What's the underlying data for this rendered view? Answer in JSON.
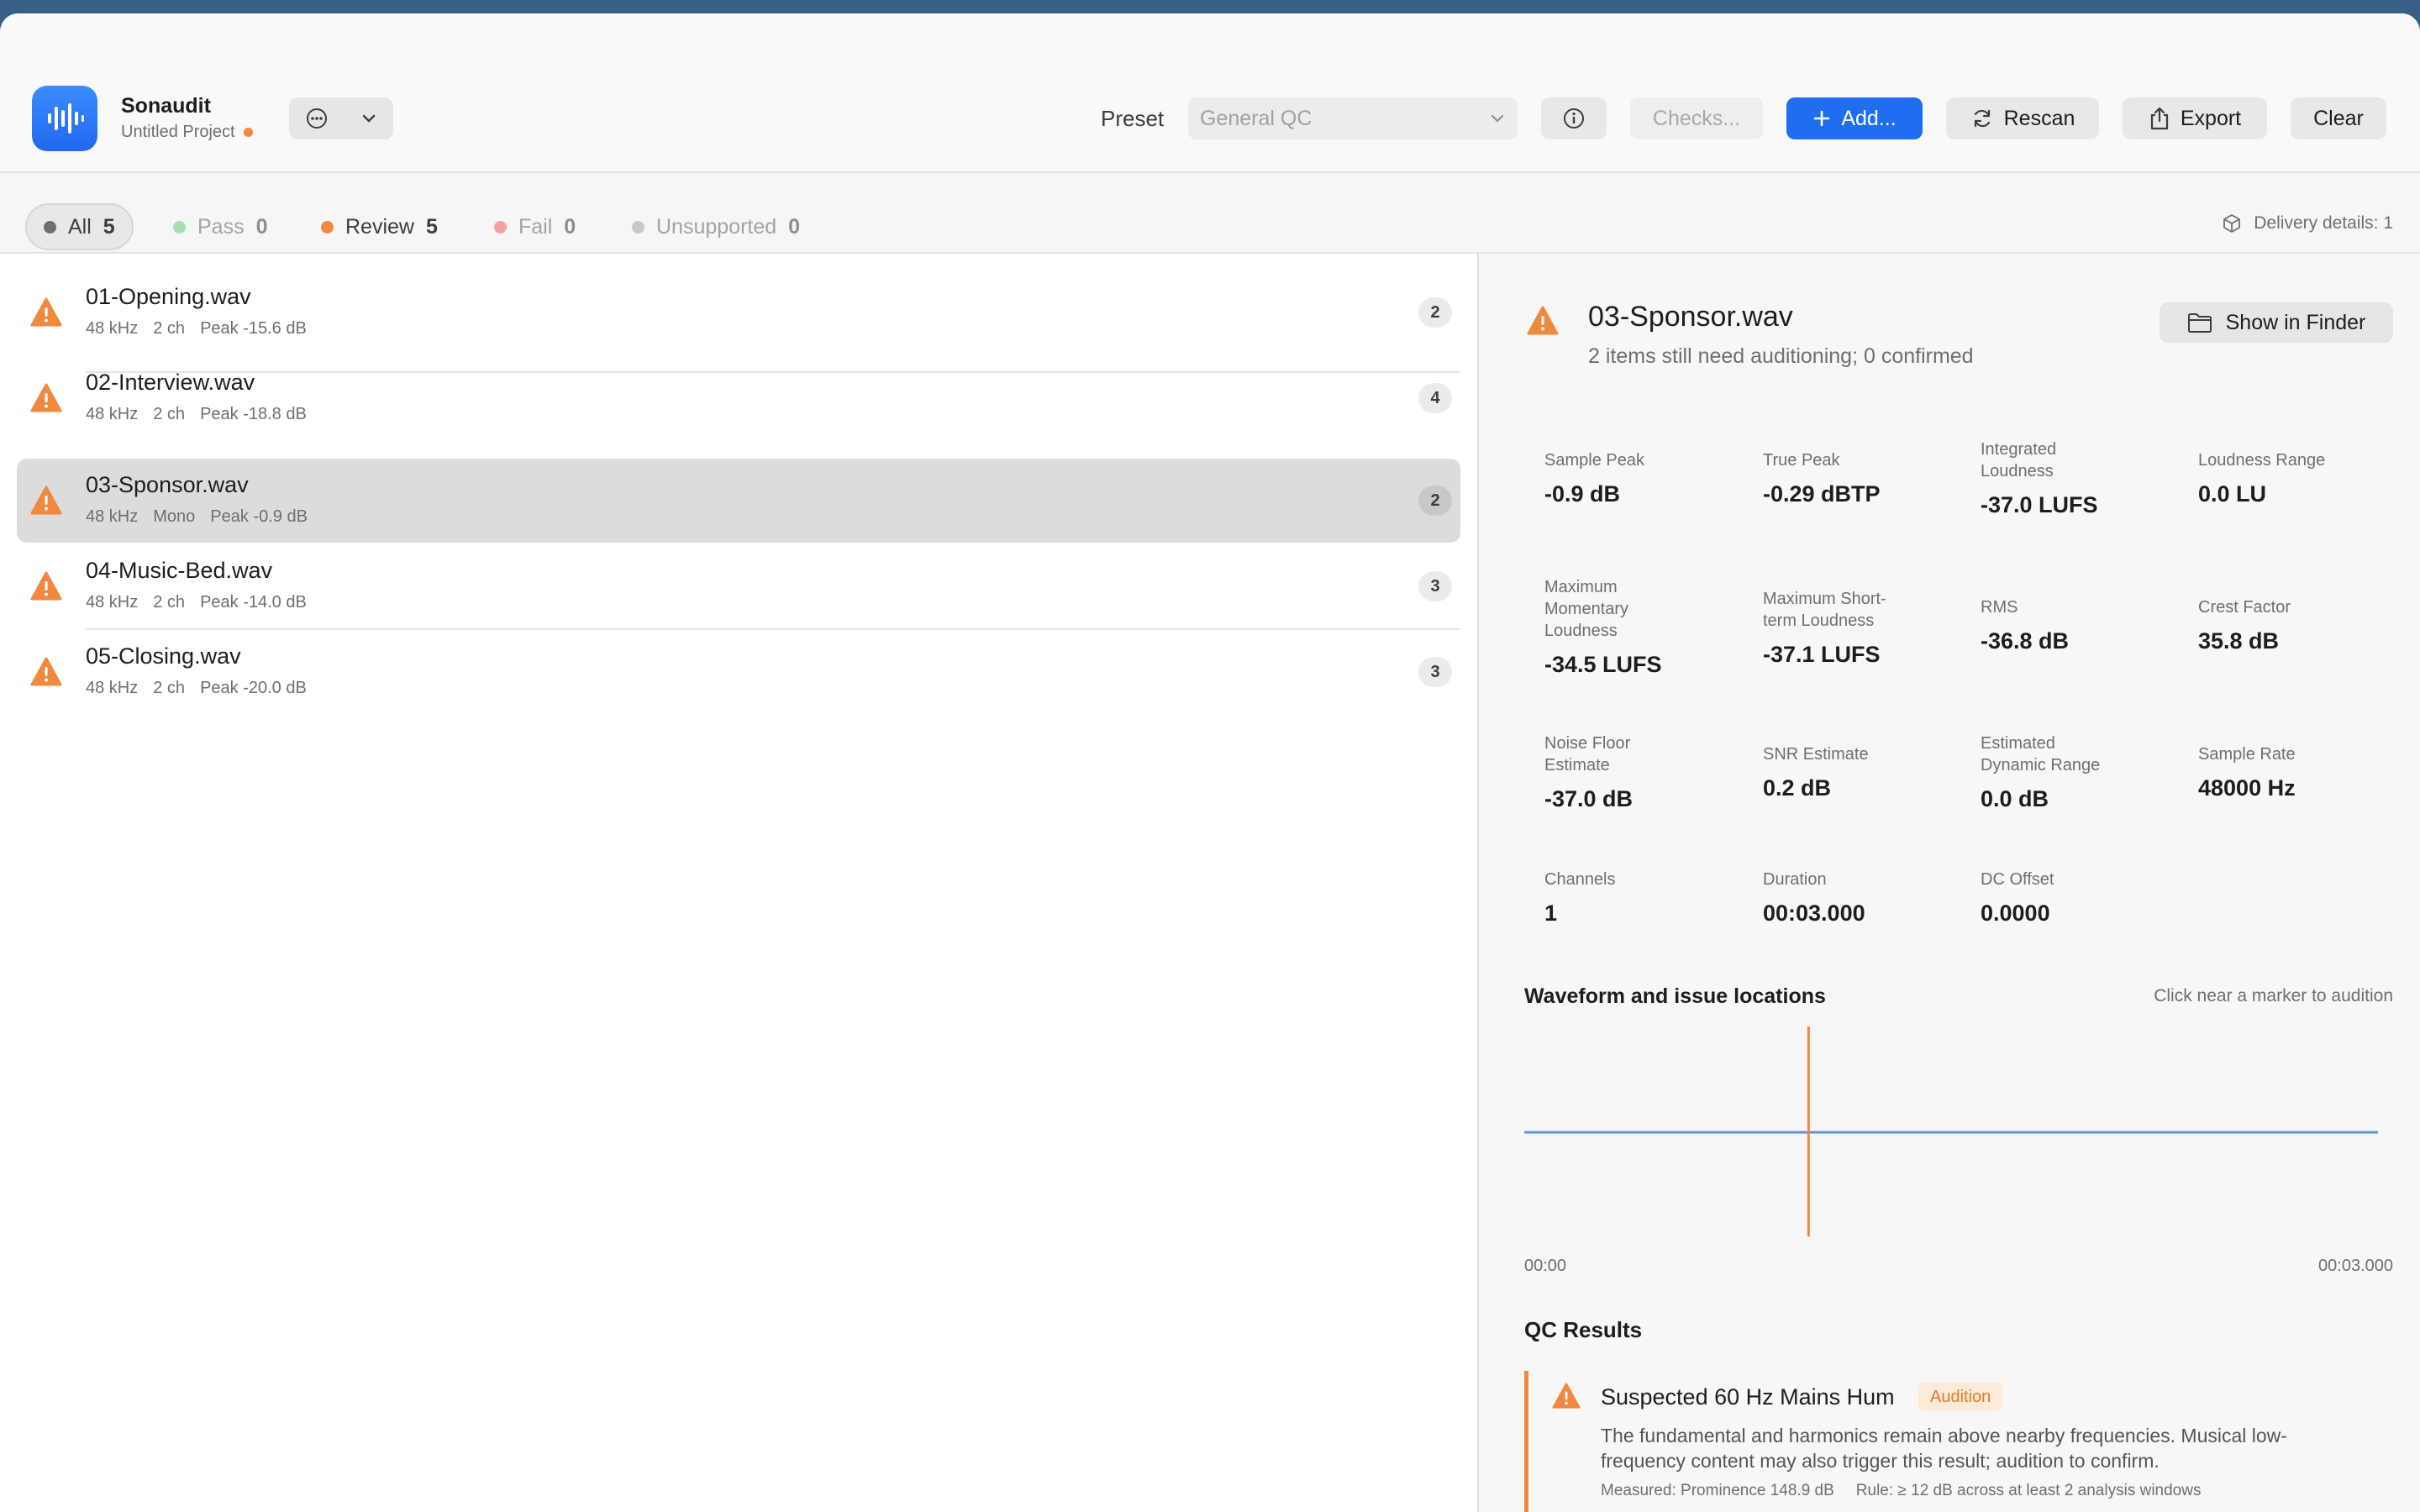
{
  "app": {
    "name": "Sonaudit",
    "project": "Untitled Project"
  },
  "toolbar": {
    "preset_label": "Preset",
    "preset_value": "General QC",
    "checks_label": "Checks...",
    "add_label": "Add...",
    "rescan_label": "Rescan",
    "export_label": "Export",
    "clear_label": "Clear"
  },
  "filters": [
    {
      "label": "All",
      "count": "5",
      "color": "#6e6e73",
      "active": true
    },
    {
      "label": "Pass",
      "count": "0",
      "color": "#a9dfb0"
    },
    {
      "label": "Review",
      "count": "5",
      "color": "#f0883e"
    },
    {
      "label": "Fail",
      "count": "0",
      "color": "#f3a1a1"
    },
    {
      "label": "Unsupported",
      "count": "0",
      "color": "#c8c8cc"
    }
  ],
  "delivery": "Delivery details: 1",
  "files": [
    {
      "name": "01-Opening.wav",
      "rate": "48 kHz",
      "channels": "2 ch",
      "peak": "Peak -15.6 dB",
      "issues": "2"
    },
    {
      "name": "02-Interview.wav",
      "rate": "48 kHz",
      "channels": "2 ch",
      "peak": "Peak -18.8 dB",
      "issues": "4"
    },
    {
      "name": "03-Sponsor.wav",
      "rate": "48 kHz",
      "channels": "Mono",
      "peak": "Peak -0.9 dB",
      "issues": "2",
      "selected": true
    },
    {
      "name": "04-Music-Bed.wav",
      "rate": "48 kHz",
      "channels": "2 ch",
      "peak": "Peak -14.0 dB",
      "issues": "3"
    },
    {
      "name": "05-Closing.wav",
      "rate": "48 kHz",
      "channels": "2 ch",
      "peak": "Peak -20.0 dB",
      "issues": "3"
    }
  ],
  "detail": {
    "title": "03-Sponsor.wav",
    "subtitle": "2 items still need auditioning; 0 confirmed",
    "finder_label": "Show in Finder",
    "metrics": [
      {
        "label": "Sample Peak",
        "value": "-0.9 dB"
      },
      {
        "label": "True Peak",
        "value": "-0.29 dBTP"
      },
      {
        "label": "Integrated Loudness",
        "value": "-37.0 LUFS"
      },
      {
        "label": "Loudness Range",
        "value": "0.0 LU"
      },
      {
        "label": "Maximum Momentary Loudness",
        "value": "-34.5 LUFS"
      },
      {
        "label": "Maximum Short-term Loudness",
        "value": "-37.1 LUFS"
      },
      {
        "label": "RMS",
        "value": "-36.8 dB"
      },
      {
        "label": "Crest Factor",
        "value": "35.8 dB"
      },
      {
        "label": "Noise Floor Estimate",
        "value": "-37.0 dB"
      },
      {
        "label": "SNR Estimate",
        "value": "0.2 dB"
      },
      {
        "label": "Estimated Dynamic Range",
        "value": "0.0 dB"
      },
      {
        "label": "Sample Rate",
        "value": "48000 Hz"
      },
      {
        "label": "Channels",
        "value": "1"
      },
      {
        "label": "Duration",
        "value": "00:03.000"
      },
      {
        "label": "DC Offset",
        "value": "0.0000"
      }
    ],
    "waveform_title": "Waveform and issue locations",
    "waveform_hint": "Click near a marker to audition",
    "waveform_start": "00:00",
    "waveform_end": "00:03.000",
    "marker_fraction": 0.333,
    "qc_title": "QC Results",
    "issue": {
      "title": "Suspected 60 Hz Mains Hum",
      "tag": "Audition",
      "description": "The fundamental and harmonics remain above nearby frequencies. Musical low-frequency content may also trigger this result; audition to confirm.",
      "measured": "Measured: Prominence 148.9 dB",
      "rule": "Rule: ≥ 12 dB across at least 2 analysis windows"
    }
  },
  "colors": {
    "accent": "#1f6ef0",
    "warning": "#f0883e",
    "waveform": "#5b93e6"
  }
}
